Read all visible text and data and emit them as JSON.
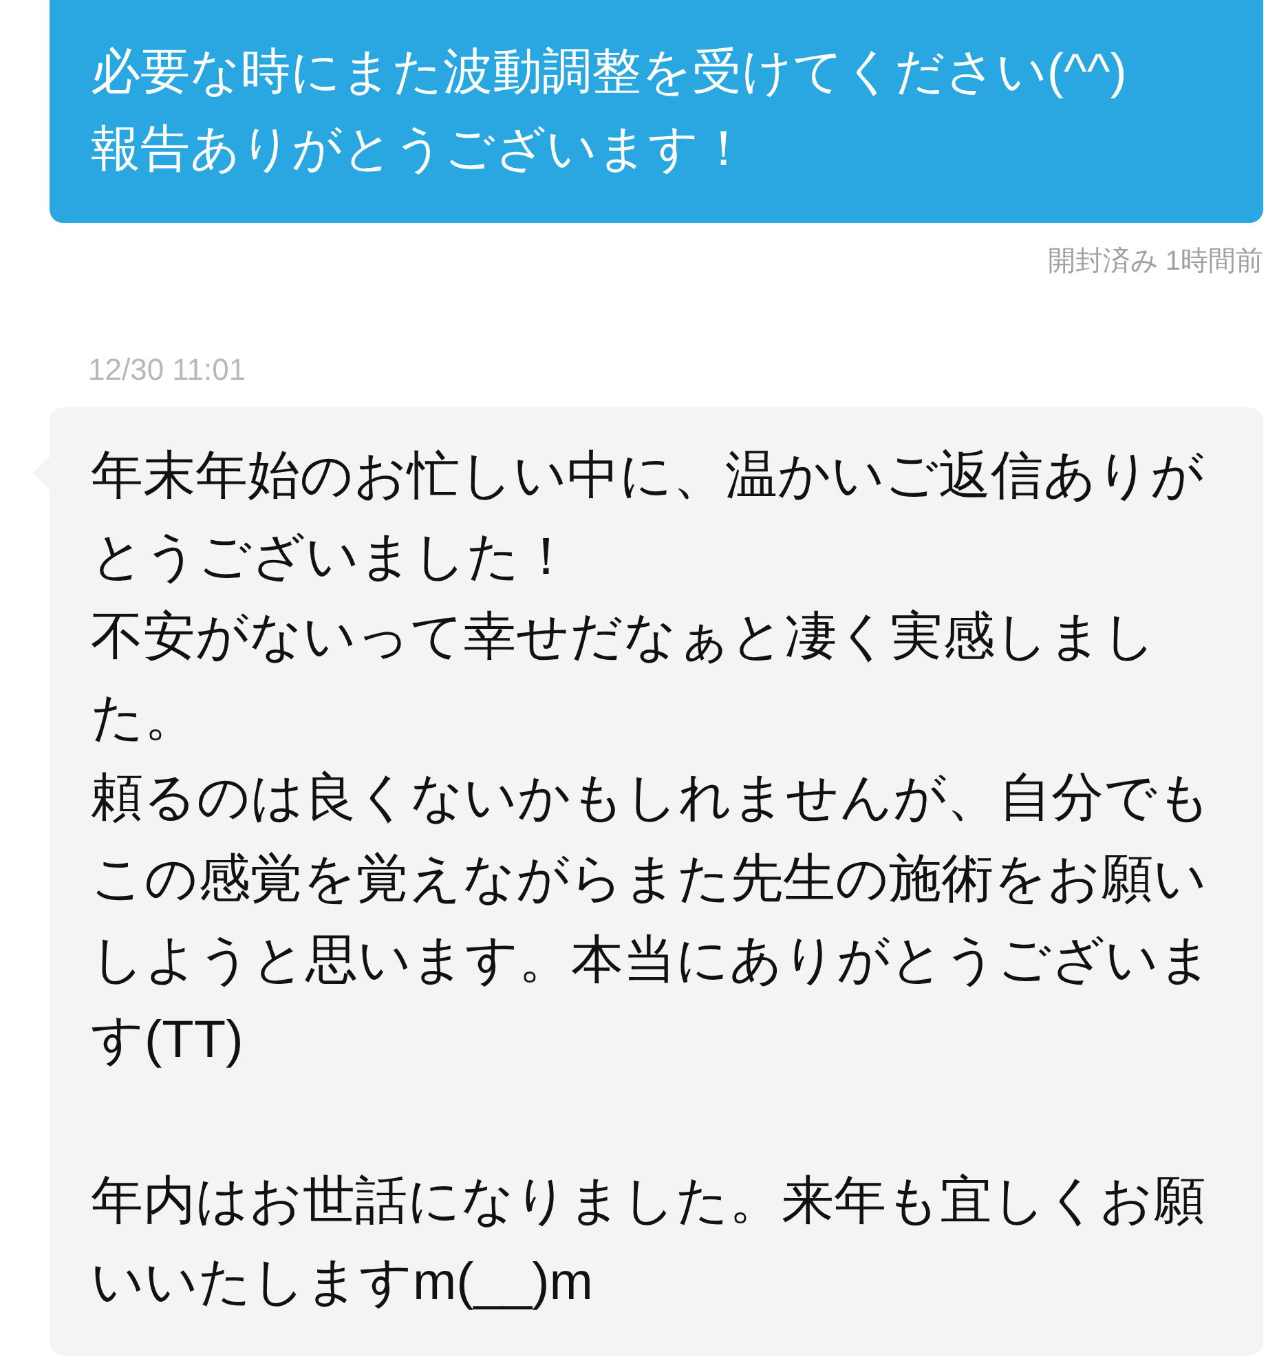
{
  "messages": [
    {
      "kind": "sent",
      "lines": [
        "必要な時にまた波動調整を受けてください(^^)",
        "報告ありがとうございます！"
      ],
      "status": "開封済み 1時間前"
    },
    {
      "kind": "received",
      "timestamp": "12/30 11:01",
      "blocks": [
        [
          "年末年始のお忙しい中に、温かいご返信ありがとうございました！",
          "不安がないって幸せだなぁと凄く実感しました。",
          "頼るのは良くないかもしれませんが、自分でもこの感覚を覚えながらまた先生の施術をお願いしようと思います。本当にありがとうございます(TT)"
        ],
        [
          "年内はお世話になりました。来年も宜しくお願いいたしますm(__)m"
        ]
      ]
    }
  ]
}
